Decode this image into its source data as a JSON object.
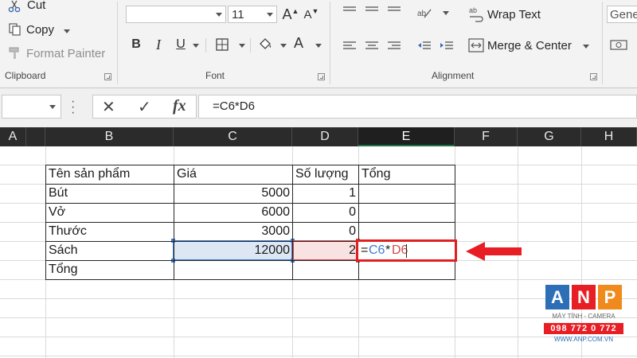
{
  "ribbon": {
    "clipboard": {
      "cut_label": "Cut",
      "copy_label": "Copy",
      "format_painter_label": "Format Painter",
      "group_label": "Clipboard"
    },
    "font": {
      "font_name": "",
      "font_size": "11",
      "group_label": "Font",
      "bold": "B",
      "italic": "I",
      "underline": "U",
      "grow": "A",
      "shrink": "A",
      "font_color": "A"
    },
    "alignment": {
      "wrap_text_label": "Wrap Text",
      "merge_center_label": "Merge & Center",
      "group_label": "Alignment"
    },
    "number": {
      "format_value": "Gene"
    }
  },
  "formula_bar": {
    "name_box_value": "",
    "cancel_symbol": "✕",
    "enter_symbol": "✓",
    "fx_label": "fx",
    "formula": "=C6*D6"
  },
  "columns": [
    "A",
    "B",
    "C",
    "D",
    "E",
    "F",
    "G",
    "H"
  ],
  "active_column": "E",
  "table": {
    "headers": [
      "Tên sản phẩm",
      "Giá",
      "Số lượng",
      "Tổng"
    ],
    "rows": [
      {
        "name": "Bút",
        "price": "5000",
        "qty": "1",
        "total": ""
      },
      {
        "name": "Vở",
        "price": "6000",
        "qty": "0",
        "total": ""
      },
      {
        "name": "Thước",
        "price": "3000",
        "qty": "0",
        "total": ""
      },
      {
        "name": "Sách",
        "price": "12000",
        "qty": "2",
        "total": ""
      },
      {
        "name": "Tổng",
        "price": "",
        "qty": "",
        "total": ""
      }
    ]
  },
  "editing_cell": {
    "eq": "=",
    "ref1": "C6",
    "op": "*",
    "ref2": "D6",
    "ref1_color": "#3d7bd1",
    "ref2_color": "#d04a4a"
  },
  "annotation": {
    "arrow_color": "#e81e25"
  },
  "watermark": {
    "letters": [
      "A",
      "N",
      "P"
    ],
    "tile_colors": [
      "#2c6fb7",
      "#e81e25",
      "#f08a1c"
    ],
    "tagline": "MÁY TÍNH - CAMERA",
    "phone": "098 772 0 772",
    "url": "WWW.ANP.COM.VN"
  }
}
